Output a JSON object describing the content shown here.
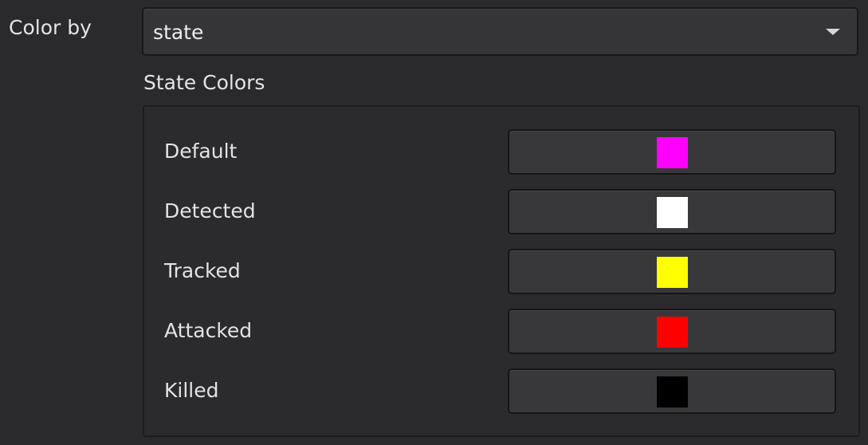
{
  "color_by": {
    "label": "Color by",
    "selected": "state"
  },
  "state_colors": {
    "title": "State Colors",
    "items": [
      {
        "label": "Default",
        "color": "#ff00ff"
      },
      {
        "label": "Detected",
        "color": "#ffffff"
      },
      {
        "label": "Tracked",
        "color": "#ffff00"
      },
      {
        "label": "Attacked",
        "color": "#ff0000"
      },
      {
        "label": "Killed",
        "color": "#000000"
      }
    ]
  }
}
